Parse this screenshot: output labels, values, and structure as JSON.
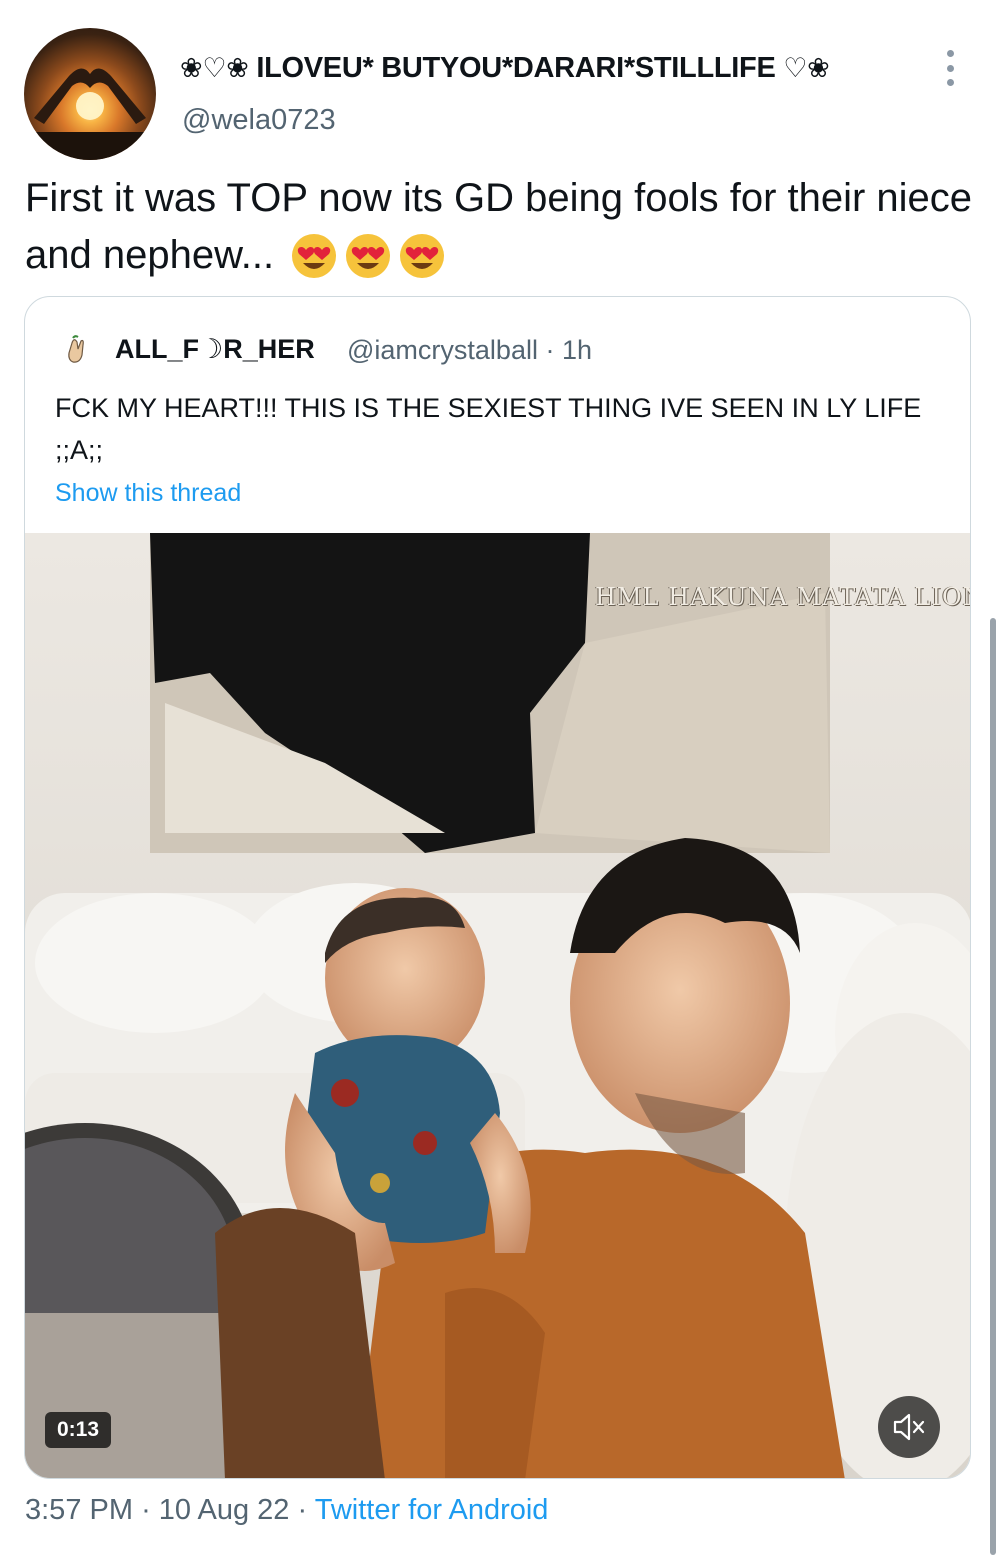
{
  "author": {
    "display_name": "ILOVEU* BUTYOU*DARARI*STILLLIFE",
    "name_decoration_left": "❀♡❀",
    "name_decoration_right": "♡❀",
    "handle": "@wela0723",
    "avatar_icon": "sunset-heart-hands-avatar"
  },
  "tweet": {
    "text": "First it was TOP now its GD being fools for their niece  and nephew...",
    "emoji": [
      "smiling-face-with-heart-eyes",
      "smiling-face-with-heart-eyes",
      "smiling-face-with-heart-eyes"
    ]
  },
  "quote": {
    "display_name": "ALL_F☽R_HER",
    "handle_time": "@iamcrystalball · 1h",
    "text": "FCK MY HEART!!! THIS IS THE SEXIEST THING IVE SEEN IN LY LIFE ;;A;;",
    "show_thread": "Show this thread",
    "avatar_icon": "hand-crossed-fingers-icon",
    "video": {
      "watermark": "HML HAKUNA MATATA LIONS",
      "duration": "0:13",
      "mute_icon": "speaker-muted-icon"
    }
  },
  "footer": {
    "time": "3:57 PM",
    "date": "10 Aug 22",
    "separator": "·",
    "source": "Twitter for Android"
  },
  "colors": {
    "link": "#1d9bf0",
    "secondary_text": "#536471",
    "border": "#cfd9de"
  }
}
